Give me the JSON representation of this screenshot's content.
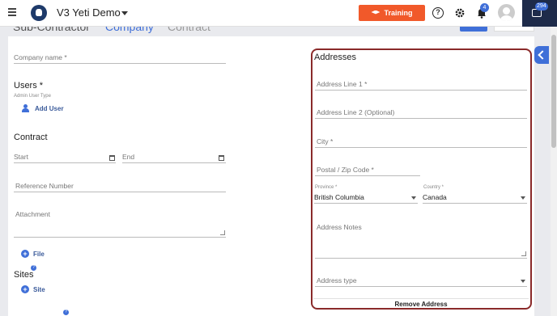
{
  "header": {
    "app_title": "V3 Yeti Demo",
    "training_label": "Training",
    "help_icon": "help-circle-icon",
    "notifications_count": "4",
    "chat_count": "294"
  },
  "tabs": [
    "Sub-Contractor",
    "Company",
    "Contract"
  ],
  "left_form": {
    "company_name_label": "Company name *",
    "users_heading": "Users *",
    "admin_user_type_label": "Admin User Type",
    "add_user_label": "Add User",
    "contract_heading": "Contract",
    "start_label": "Start",
    "end_label": "End",
    "reference_number_label": "Reference Number",
    "attachment_label": "Attachment",
    "file_label": "File",
    "sites_heading": "Sites",
    "site_label": "Site"
  },
  "addresses": {
    "title": "Addresses",
    "line1_label": "Address Line 1 *",
    "line2_label": "Address Line 2 (Optional)",
    "city_label": "City *",
    "postal_label": "Postal / Zip Code *",
    "province_label": "Province *",
    "province_value": "British Columbia",
    "country_label": "Country *",
    "country_value": "Canada",
    "notes_label": "Address Notes",
    "address_type_label": "Address type",
    "remove_label": "Remove Address"
  },
  "colors": {
    "accent": "#3f6fd8",
    "training": "#f1592a",
    "address_border": "#8a2a2a"
  }
}
